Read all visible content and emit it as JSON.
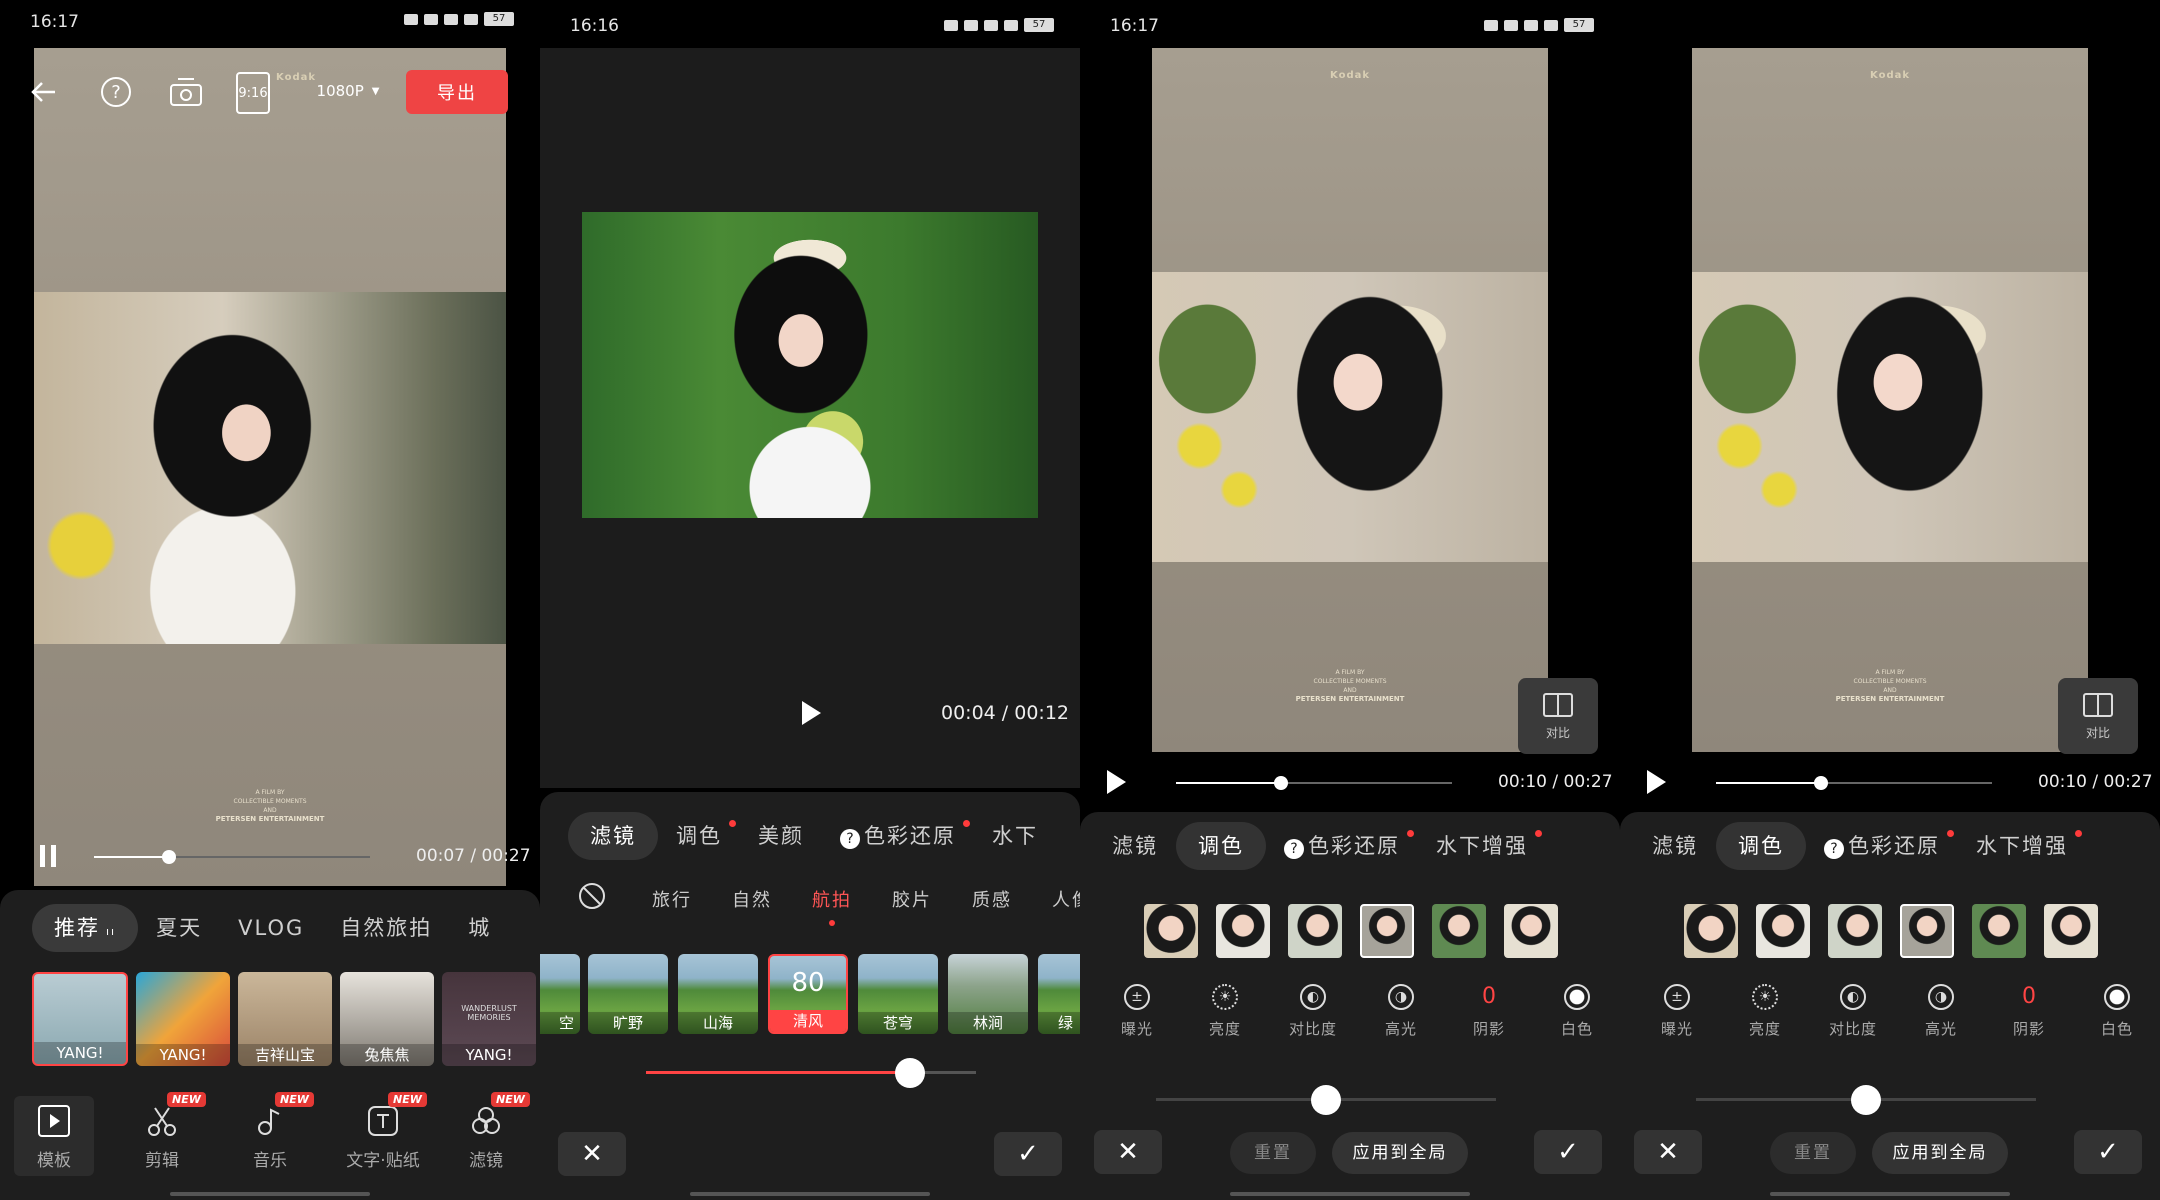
{
  "colors": {
    "accent": "#ff4444",
    "export_button": "#ef4444",
    "panel": "#1e1e1e"
  },
  "screen1": {
    "status": {
      "time": "16:17",
      "battery": "57"
    },
    "toolbar": {
      "resolution": "1080P",
      "export": "导出",
      "ratio": "9:16"
    },
    "video": {
      "brand": "Kodak",
      "credits_line1": "A FILM BY",
      "credits_line2": "COLLECTIBLE MOMENTS",
      "credits_line3": "AND",
      "credits_line4": "PETERSEN ENTERTAINMENT"
    },
    "playback": {
      "time": "00:07 / 00:27",
      "progress": 0.27
    },
    "categories": [
      {
        "label": "推荐",
        "active": true
      },
      {
        "label": "夏天"
      },
      {
        "label": "VLOG"
      },
      {
        "label": "自然旅拍"
      },
      {
        "label": "城"
      }
    ],
    "templates": [
      {
        "label": "YANG!"
      },
      {
        "label": "YANG!"
      },
      {
        "label": "吉祥山宝"
      },
      {
        "label": "兔焦焦"
      },
      {
        "label": "YANG!",
        "overlay": "WANDERLUST MEMORIES"
      }
    ],
    "nav": [
      {
        "label": "模板",
        "icon": "template-icon",
        "badge": ""
      },
      {
        "label": "剪辑",
        "icon": "scissors-icon",
        "badge": "NEW"
      },
      {
        "label": "音乐",
        "icon": "music-icon",
        "badge": "NEW"
      },
      {
        "label": "文字·贴纸",
        "icon": "text-sticker-icon",
        "badge": "NEW"
      },
      {
        "label": "滤镜",
        "icon": "filter-icon",
        "badge": "NEW"
      }
    ]
  },
  "screen2": {
    "status": {
      "time": "16:16",
      "battery": "57"
    },
    "playback": {
      "time": "00:04 / 00:12"
    },
    "tabs": [
      {
        "label": "滤镜",
        "active": true
      },
      {
        "label": "调色",
        "dot": true
      },
      {
        "label": "美颜"
      },
      {
        "label": "色彩还原",
        "dot": true,
        "help": true
      },
      {
        "label": "水下"
      }
    ],
    "categories": [
      {
        "label": "旅行"
      },
      {
        "label": "自然"
      },
      {
        "label": "航拍",
        "active": true
      },
      {
        "label": "胶片"
      },
      {
        "label": "质感"
      },
      {
        "label": "人像"
      }
    ],
    "filters": [
      {
        "label": "空"
      },
      {
        "label": "旷野"
      },
      {
        "label": "山海"
      },
      {
        "label": "清风",
        "selected": true,
        "value": "80"
      },
      {
        "label": "苍穹"
      },
      {
        "label": "林涧"
      },
      {
        "label": "绿"
      }
    ],
    "intensity": 0.8
  },
  "screen3": {
    "status": {
      "time": "16:17",
      "battery": "57"
    },
    "playback": {
      "time": "00:10 / 00:27",
      "progress": 0.38
    },
    "compare": "对比",
    "tabs": [
      {
        "label": "滤镜"
      },
      {
        "label": "调色",
        "active": true
      },
      {
        "label": "色彩还原",
        "dot": true,
        "help": true
      },
      {
        "label": "水下增强",
        "dot": true
      }
    ],
    "adjust": [
      {
        "label": "曝光",
        "icon": "exposure-icon"
      },
      {
        "label": "亮度",
        "icon": "brightness-icon"
      },
      {
        "label": "对比度",
        "icon": "contrast-icon"
      },
      {
        "label": "高光",
        "icon": "highlight-icon"
      },
      {
        "label": "阴影",
        "icon": "shadow-icon",
        "value": "0"
      },
      {
        "label": "白色",
        "icon": "white-icon"
      }
    ],
    "reset": "重置",
    "apply_all": "应用到全局"
  },
  "screen4": {
    "status": {
      "time": "",
      "battery": ""
    },
    "playback": {
      "time": "00:10 / 00:27",
      "progress": 0.38
    },
    "compare": "对比",
    "tabs": [
      {
        "label": "滤镜"
      },
      {
        "label": "调色",
        "active": true
      },
      {
        "label": "色彩还原",
        "dot": true,
        "help": true
      },
      {
        "label": "水下增强",
        "dot": true
      }
    ],
    "adjust": [
      {
        "label": "曝光",
        "icon": "exposure-icon"
      },
      {
        "label": "亮度",
        "icon": "brightness-icon"
      },
      {
        "label": "对比度",
        "icon": "contrast-icon"
      },
      {
        "label": "高光",
        "icon": "highlight-icon"
      },
      {
        "label": "阴影",
        "icon": "shadow-icon",
        "value": "0"
      },
      {
        "label": "白色",
        "icon": "white-icon"
      }
    ],
    "reset": "重置",
    "apply_all": "应用到全局"
  }
}
